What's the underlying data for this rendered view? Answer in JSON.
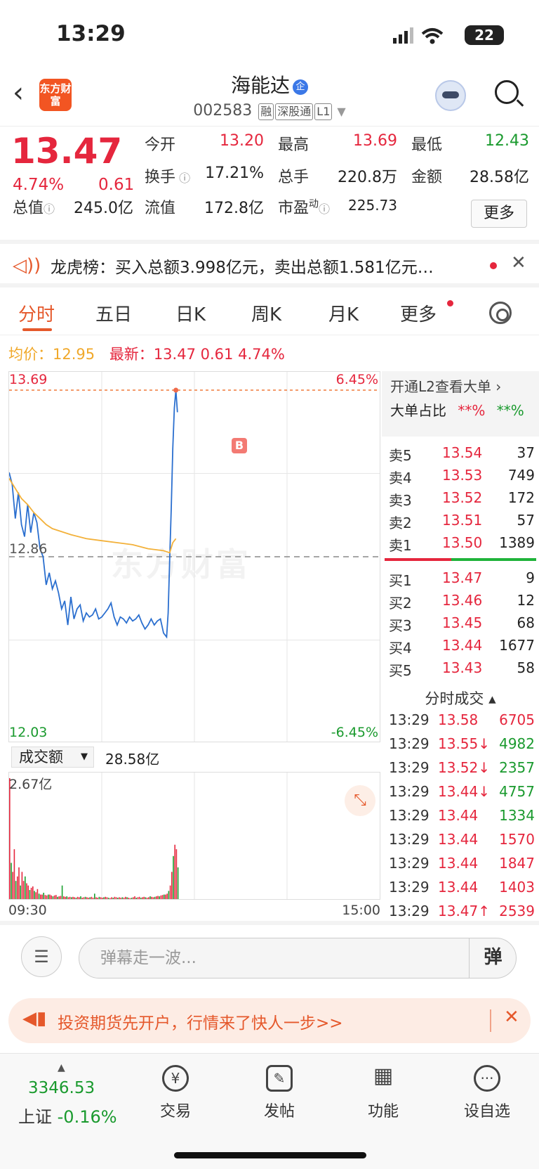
{
  "status": {
    "time": "13:29",
    "battery": "22"
  },
  "header": {
    "logo": "东方财富",
    "name": "海能达",
    "name_badge": "企",
    "code": "002583",
    "tags": [
      "融",
      "深股通",
      "L1"
    ]
  },
  "quote": {
    "price": "13.47",
    "pct": "4.74%",
    "change": "0.61",
    "open_label": "今开",
    "open": "13.20",
    "high_label": "最高",
    "high": "13.69",
    "low_label": "最低",
    "low": "12.43",
    "turnover_label": "换手",
    "turnover": "17.21%",
    "volume_label": "总手",
    "volume": "220.8万",
    "amount_label": "金额",
    "amount": "28.58亿",
    "mktcap_label": "总值",
    "mktcap": "245.0亿",
    "float_label": "流值",
    "float": "172.8亿",
    "pe_label": "市盈",
    "pe_sup": "动",
    "pe": "225.73",
    "more": "更多"
  },
  "dragon": {
    "text": "龙虎榜：买入总额3.998亿元，卖出总额1.581亿元…"
  },
  "tabs": [
    "分时",
    "五日",
    "日K",
    "周K",
    "月K",
    "更多"
  ],
  "info": {
    "avg_label": "均价：",
    "avg": "12.95",
    "last_label": "最新：",
    "last": "13.47",
    "chg": "0.61",
    "pct": "4.74%"
  },
  "chart_labels": {
    "top_price": "13.69",
    "top_pct": "6.45%",
    "mid_price": "12.86",
    "bottom_price": "12.03",
    "bottom_pct": "-6.45%",
    "marker": "B",
    "watermark": "东方财富"
  },
  "chart_data": {
    "type": "line",
    "x_start": "09:30",
    "x_end": "15:00",
    "ylim": [
      12.03,
      13.69
    ],
    "prev_close": 12.86,
    "series": [
      {
        "name": "最新",
        "color": "#2b6fcf",
        "points": [
          [
            0,
            13.28
          ],
          [
            2,
            13.22
          ],
          [
            4,
            13.05
          ],
          [
            6,
            13.18
          ],
          [
            8,
            13.02
          ],
          [
            10,
            12.96
          ],
          [
            12,
            13.12
          ],
          [
            14,
            12.98
          ],
          [
            16,
            13.08
          ],
          [
            18,
            13.03
          ],
          [
            20,
            12.9
          ],
          [
            22,
            12.86
          ],
          [
            24,
            12.72
          ],
          [
            26,
            12.78
          ],
          [
            28,
            12.7
          ],
          [
            30,
            12.74
          ],
          [
            32,
            12.68
          ],
          [
            34,
            12.6
          ],
          [
            36,
            12.64
          ],
          [
            38,
            12.52
          ],
          [
            40,
            12.66
          ],
          [
            42,
            12.55
          ],
          [
            44,
            12.6
          ],
          [
            46,
            12.62
          ],
          [
            48,
            12.54
          ],
          [
            50,
            12.58
          ],
          [
            52,
            12.56
          ],
          [
            54,
            12.57
          ],
          [
            56,
            12.6
          ],
          [
            58,
            12.55
          ],
          [
            60,
            12.56
          ],
          [
            62,
            12.58
          ],
          [
            64,
            12.6
          ],
          [
            66,
            12.63
          ],
          [
            68,
            12.56
          ],
          [
            70,
            12.52
          ],
          [
            72,
            12.56
          ],
          [
            74,
            12.55
          ],
          [
            76,
            12.53
          ],
          [
            78,
            12.56
          ],
          [
            80,
            12.54
          ],
          [
            82,
            12.55
          ],
          [
            84,
            12.57
          ],
          [
            86,
            12.53
          ],
          [
            88,
            12.5
          ],
          [
            90,
            12.52
          ],
          [
            92,
            12.55
          ],
          [
            94,
            12.52
          ],
          [
            96,
            12.54
          ],
          [
            98,
            12.55
          ],
          [
            100,
            12.48
          ],
          [
            102,
            12.46
          ],
          [
            103,
            12.58
          ],
          [
            104,
            12.85
          ],
          [
            105,
            13.1
          ],
          [
            106,
            13.4
          ],
          [
            107,
            13.6
          ],
          [
            108,
            13.69
          ],
          [
            109,
            13.58
          ]
        ]
      },
      {
        "name": "均价",
        "color": "#f3b13a",
        "points": [
          [
            0,
            13.25
          ],
          [
            4,
            13.2
          ],
          [
            8,
            13.15
          ],
          [
            12,
            13.12
          ],
          [
            16,
            13.08
          ],
          [
            20,
            13.05
          ],
          [
            24,
            13.02
          ],
          [
            28,
            13.0
          ],
          [
            32,
            12.99
          ],
          [
            40,
            12.97
          ],
          [
            50,
            12.95
          ],
          [
            60,
            12.94
          ],
          [
            70,
            12.93
          ],
          [
            80,
            12.92
          ],
          [
            90,
            12.9
          ],
          [
            100,
            12.89
          ],
          [
            104,
            12.88
          ],
          [
            106,
            12.93
          ],
          [
            108,
            12.95
          ]
        ]
      }
    ],
    "total_points": 240
  },
  "volume": {
    "selector": "成交额",
    "total": "28.58亿",
    "max_label": "2.67亿",
    "bars": [
      2.67,
      0.8,
      0.6,
      1.1,
      0.4,
      0.5,
      0.7,
      0.3,
      0.6,
      0.4,
      0.5,
      0.35,
      0.3,
      0.2,
      0.25,
      0.28,
      0.18,
      0.15,
      0.22,
      0.12,
      0.1,
      0.1,
      0.14,
      0.09,
      0.08,
      0.1,
      0.1,
      0.08,
      0.06,
      0.08,
      0.09,
      0.05,
      0.06,
      0.07,
      0.3,
      0.06,
      0.05,
      0.06,
      0.04,
      0.05,
      0.04,
      0.05,
      0.04,
      0.03,
      0.05,
      0.04,
      0.06,
      0.03,
      0.04,
      0.05,
      0.04,
      0.03,
      0.04,
      0.05,
      0.03,
      0.12,
      0.04,
      0.03,
      0.05,
      0.04,
      0.03,
      0.04,
      0.05,
      0.04,
      0.03,
      0.02,
      0.04,
      0.03,
      0.05,
      0.04,
      0.03,
      0.04,
      0.03,
      0.04,
      0.03,
      0.05,
      0.04,
      0.03,
      0.02,
      0.03,
      0.04,
      0.06,
      0.03,
      0.04,
      0.05,
      0.03,
      0.04,
      0.05,
      0.04,
      0.03,
      0.04,
      0.06,
      0.05,
      0.04,
      0.05,
      0.06,
      0.07,
      0.06,
      0.08,
      0.09,
      0.1,
      0.1,
      0.12,
      0.18,
      0.3,
      0.6,
      0.95,
      1.2,
      1.1,
      0.7
    ],
    "time_start": "09:30",
    "time_end": "15:00"
  },
  "panel": {
    "l2_line": "开通L2查看大单 ›",
    "big_label": "大单占比",
    "big_buy": "**%",
    "big_sell": "**%",
    "asks": [
      {
        "name": "卖5",
        "price": "13.54",
        "vol": "37"
      },
      {
        "name": "卖4",
        "price": "13.53",
        "vol": "749"
      },
      {
        "name": "卖3",
        "price": "13.52",
        "vol": "172"
      },
      {
        "name": "卖2",
        "price": "13.51",
        "vol": "57"
      },
      {
        "name": "卖1",
        "price": "13.50",
        "vol": "1389"
      }
    ],
    "bids": [
      {
        "name": "买1",
        "price": "13.47",
        "vol": "9"
      },
      {
        "name": "买2",
        "price": "13.46",
        "vol": "12"
      },
      {
        "name": "买3",
        "price": "13.45",
        "vol": "68"
      },
      {
        "name": "买4",
        "price": "13.44",
        "vol": "1677"
      },
      {
        "name": "买5",
        "price": "13.43",
        "vol": "58"
      }
    ],
    "ticks_title": "分时成交 ▴",
    "ticks": [
      {
        "time": "13:29",
        "price": "13.58",
        "vol": "6705",
        "dir": "",
        "side": "buy"
      },
      {
        "time": "13:29",
        "price": "13.55↓",
        "vol": "4982",
        "dir": "",
        "side": "sell"
      },
      {
        "time": "13:29",
        "price": "13.52↓",
        "vol": "2357",
        "dir": "",
        "side": "sell"
      },
      {
        "time": "13:29",
        "price": "13.44↓",
        "vol": "4757",
        "dir": "",
        "side": "sell"
      },
      {
        "time": "13:29",
        "price": "13.44",
        "vol": "1334",
        "dir": "",
        "side": "sell"
      },
      {
        "time": "13:29",
        "price": "13.44",
        "vol": "1570",
        "dir": "",
        "side": "buy"
      },
      {
        "time": "13:29",
        "price": "13.44",
        "vol": "1847",
        "dir": "",
        "side": "buy"
      },
      {
        "time": "13:29",
        "price": "13.44",
        "vol": "1403",
        "dir": "",
        "side": "buy"
      },
      {
        "time": "13:29",
        "price": "13.47↑",
        "vol": "2539",
        "dir": "",
        "side": "buy"
      }
    ]
  },
  "danmu": {
    "placeholder": "弹幕走一波...",
    "button": "弹"
  },
  "promo": {
    "text": "投资期货先开户，行情来了快人一步>>"
  },
  "bottom": {
    "index_value": "3346.53",
    "index_name": "上证",
    "index_pct": "-0.16%",
    "nav": [
      "交易",
      "发帖",
      "功能",
      "设自选"
    ]
  }
}
